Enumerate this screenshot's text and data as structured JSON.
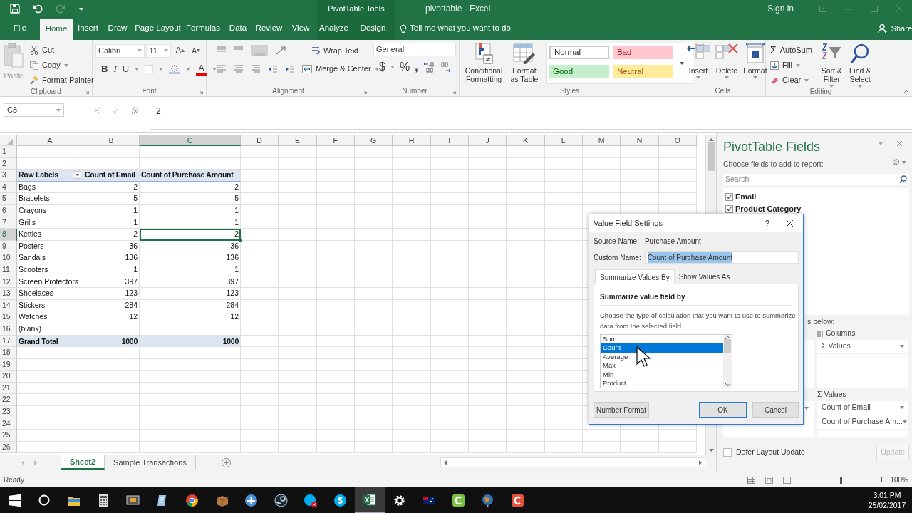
{
  "title_bar": {
    "context_label": "PivotTable Tools",
    "title": "pivottable  -  Excel",
    "sign_in": "Sign in"
  },
  "tabs": [
    {
      "label": "File",
      "selected": false,
      "kind": "plain"
    },
    {
      "label": "Home",
      "selected": true,
      "kind": "plain"
    },
    {
      "label": "Insert",
      "selected": false,
      "kind": "plain"
    },
    {
      "label": "Draw",
      "selected": false,
      "kind": "plain"
    },
    {
      "label": "Page Layout",
      "selected": false,
      "kind": "plain"
    },
    {
      "label": "Formulas",
      "selected": false,
      "kind": "plain"
    },
    {
      "label": "Data",
      "selected": false,
      "kind": "plain"
    },
    {
      "label": "Review",
      "selected": false,
      "kind": "plain"
    },
    {
      "label": "View",
      "selected": false,
      "kind": "plain"
    },
    {
      "label": "Analyze",
      "selected": false,
      "kind": "context"
    },
    {
      "label": "Design",
      "selected": false,
      "kind": "context"
    }
  ],
  "tell_me": "Tell me what you want to do",
  "share": "Share",
  "ribbon": {
    "clipboard": {
      "paste": "Paste",
      "cut": "Cut",
      "copy": "Copy",
      "format_painter": "Format Painter",
      "label": "Clipboard"
    },
    "font": {
      "name": "Calibri",
      "size": "11",
      "grow": "A",
      "shrink": "A",
      "bold": "B",
      "italic": "I",
      "underline": "U",
      "color_letter": "A",
      "label": "Font"
    },
    "alignment": {
      "wrap": "Wrap Text",
      "merge": "Merge & Center",
      "label": "Alignment"
    },
    "number": {
      "format": "General",
      "currency": "$",
      "percent": "%",
      "comma": ",",
      "label": "Number"
    },
    "styles": {
      "conditional": "Conditional Formatting",
      "format_table": "Format as Table",
      "label": "Styles",
      "cells": [
        {
          "label": "Normal",
          "kind": "normal"
        },
        {
          "label": "Bad",
          "kind": "bad"
        },
        {
          "label": "Good",
          "kind": "good"
        },
        {
          "label": "Neutral",
          "kind": "neutral"
        }
      ]
    },
    "cells": {
      "insert": "Insert",
      "delete": "Delete",
      "format": "Format",
      "label": "Cells"
    },
    "editing": {
      "sigma": "Σ",
      "autosum": "AutoSum",
      "fill": "Fill",
      "clear": "Clear",
      "sort": "Sort & Filter",
      "find": "Find & Select",
      "label": "Editing"
    }
  },
  "formula_bar": {
    "name_box": "C8",
    "fx": "fx",
    "value": "2"
  },
  "sheet": {
    "columns": [
      {
        "label": "A",
        "selected": false
      },
      {
        "label": "B",
        "selected": false
      },
      {
        "label": "C",
        "selected": true
      },
      {
        "label": "D",
        "selected": false
      },
      {
        "label": "E",
        "selected": false
      },
      {
        "label": "F",
        "selected": false
      },
      {
        "label": "G",
        "selected": false
      },
      {
        "label": "H",
        "selected": false
      },
      {
        "label": "I",
        "selected": false
      },
      {
        "label": "J",
        "selected": false
      },
      {
        "label": "K",
        "selected": false
      },
      {
        "label": "L",
        "selected": false
      },
      {
        "label": "M",
        "selected": false
      },
      {
        "label": "N",
        "selected": false
      },
      {
        "label": "O",
        "selected": false
      }
    ],
    "rows": [
      {
        "number": "1",
        "selected": false,
        "kind": "empty"
      },
      {
        "number": "2",
        "selected": false,
        "kind": "empty"
      },
      {
        "number": "3",
        "selected": false,
        "kind": "header",
        "cells": [
          "Row Labels",
          "Count of Email",
          "Count of Purchase Amount"
        ]
      },
      {
        "number": "4",
        "selected": false,
        "kind": "item",
        "cells": [
          "Bags",
          "2",
          "2"
        ]
      },
      {
        "number": "5",
        "selected": false,
        "kind": "item",
        "cells": [
          "Bracelets",
          "5",
          "5"
        ]
      },
      {
        "number": "6",
        "selected": false,
        "kind": "item",
        "cells": [
          "Crayons",
          "1",
          "1"
        ]
      },
      {
        "number": "7",
        "selected": false,
        "kind": "item",
        "cells": [
          "Grills",
          "1",
          "1"
        ]
      },
      {
        "number": "8",
        "selected": true,
        "kind": "item",
        "cells": [
          "Kettles",
          "2",
          "2"
        ]
      },
      {
        "number": "9",
        "selected": false,
        "kind": "item",
        "cells": [
          "Posters",
          "36",
          "36"
        ]
      },
      {
        "number": "10",
        "selected": false,
        "kind": "item",
        "cells": [
          "Sandals",
          "136",
          "136"
        ]
      },
      {
        "number": "11",
        "selected": false,
        "kind": "item",
        "cells": [
          "Scooters",
          "1",
          "1"
        ]
      },
      {
        "number": "12",
        "selected": false,
        "kind": "item",
        "cells": [
          "Screen Protectors",
          "397",
          "397"
        ]
      },
      {
        "number": "13",
        "selected": false,
        "kind": "item",
        "cells": [
          "Shoelaces",
          "123",
          "123"
        ]
      },
      {
        "number": "14",
        "selected": false,
        "kind": "item",
        "cells": [
          "Stickers",
          "284",
          "284"
        ]
      },
      {
        "number": "15",
        "selected": false,
        "kind": "item",
        "cells": [
          "Watches",
          "12",
          "12"
        ]
      },
      {
        "number": "16",
        "selected": false,
        "kind": "item",
        "cells": [
          "(blank)"
        ]
      },
      {
        "number": "17",
        "selected": false,
        "kind": "total",
        "cells": [
          "Grand Total",
          "1000",
          "1000"
        ]
      },
      {
        "number": "18",
        "selected": false,
        "kind": "empty"
      },
      {
        "number": "19",
        "selected": false,
        "kind": "empty"
      },
      {
        "number": "20",
        "selected": false,
        "kind": "empty"
      },
      {
        "number": "21",
        "selected": false,
        "kind": "empty"
      },
      {
        "number": "22",
        "selected": false,
        "kind": "empty"
      },
      {
        "number": "23",
        "selected": false,
        "kind": "empty"
      },
      {
        "number": "24",
        "selected": false,
        "kind": "empty"
      },
      {
        "number": "25",
        "selected": false,
        "kind": "empty"
      },
      {
        "number": "26",
        "selected": false,
        "kind": "empty"
      }
    ]
  },
  "sheet_tabs": [
    {
      "label": "Sheet2",
      "selected": true
    },
    {
      "label": "Sample Transactions",
      "selected": false
    }
  ],
  "pivot_panel": {
    "title": "PivotTable Fields",
    "subtitle": "Choose fields to add to report:",
    "search_placeholder": "Search",
    "fields": [
      {
        "label": "Email",
        "checked": true
      },
      {
        "label": "Product Category",
        "checked": true
      }
    ],
    "areas_hint": "s below:",
    "columns_label": "Columns",
    "column_items": [
      "Σ Values"
    ],
    "values_label": "Σ Values",
    "value_items": [
      "Count of Email",
      "Count of Purchase Am..."
    ],
    "defer": {
      "label": "Defer Layout Update",
      "checked": false
    },
    "update": "Update"
  },
  "dialog": {
    "title": "Value Field Settings",
    "help": "?",
    "source_label": "Source Name:",
    "source_value": "Purchase Amount",
    "custom_label": "Custom Name:",
    "custom_value": {
      "text": "Count of Purchase Amount",
      "highlighted": true
    },
    "tabs": [
      {
        "label": "Summarize Values By",
        "selected": true
      },
      {
        "label": "Show Values As",
        "selected": false
      }
    ],
    "section_title": "Summarize value field by",
    "description": "Choose the type of calculation that you want to use to summarize data from the selected field",
    "options": [
      {
        "label": "Sum",
        "selected": false
      },
      {
        "label": "Count",
        "selected": true
      },
      {
        "label": "Average",
        "selected": false
      },
      {
        "label": "Max",
        "selected": false
      },
      {
        "label": "Min",
        "selected": false
      },
      {
        "label": "Product",
        "selected": false
      }
    ],
    "number_format": "Number Format",
    "ok": "OK",
    "cancel": "Cancel"
  },
  "status_bar": {
    "text": "Ready",
    "zoom": "100%",
    "zoom_slider": {
      "level": 0.5
    }
  },
  "taskbar": {
    "apps": [
      {
        "kind": "start",
        "selected": false
      },
      {
        "kind": "search",
        "selected": false
      },
      {
        "kind": "folder",
        "selected": false
      },
      {
        "kind": "calculator",
        "selected": false
      },
      {
        "kind": "slides",
        "selected": false
      },
      {
        "kind": "notes",
        "selected": false
      },
      {
        "kind": "chrome",
        "selected": false
      },
      {
        "kind": "box",
        "selected": false
      },
      {
        "kind": "network",
        "selected": false
      },
      {
        "kind": "steam",
        "selected": false
      },
      {
        "kind": "skype-off",
        "selected": false
      },
      {
        "kind": "skype",
        "selected": false
      },
      {
        "kind": "excel",
        "selected": true
      },
      {
        "kind": "gear",
        "selected": false
      },
      {
        "kind": "flag",
        "selected": false
      },
      {
        "kind": "green-c",
        "selected": false
      },
      {
        "kind": "globe",
        "selected": false
      },
      {
        "kind": "red-c",
        "selected": false
      }
    ],
    "time": "3:01 PM",
    "date": "25/02/2017"
  }
}
